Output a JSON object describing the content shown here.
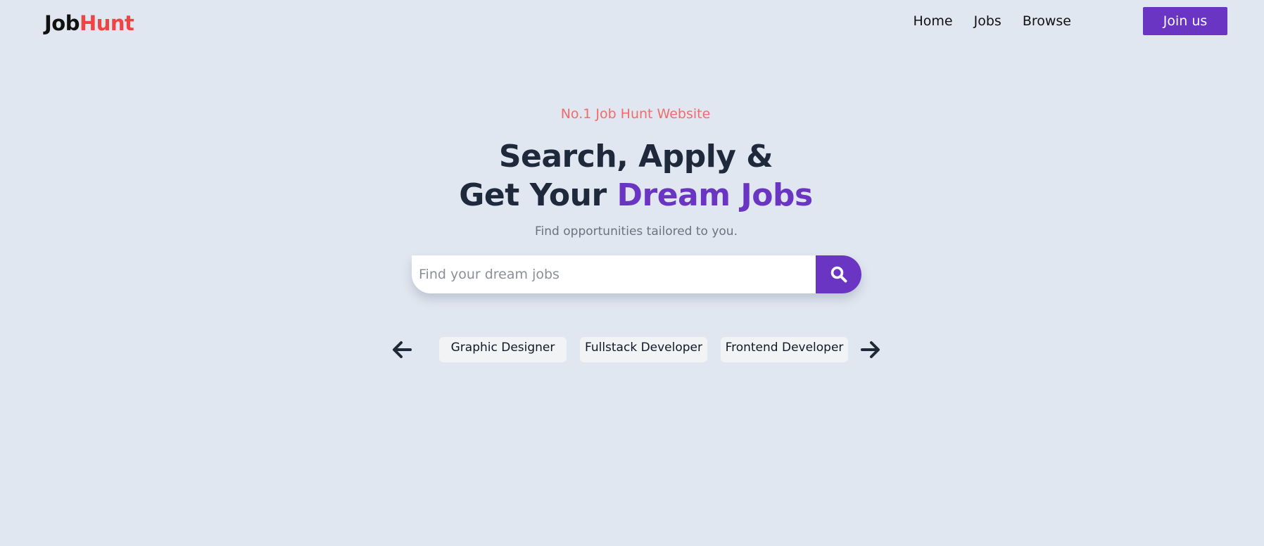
{
  "brand": {
    "part1": "Job",
    "part2": "Hunt"
  },
  "nav": {
    "links": [
      "Home",
      "Jobs",
      "Browse"
    ],
    "cta_label": "Join us"
  },
  "hero": {
    "badge": "No.1 Job Hunt Website",
    "headline_line1": "Search, Apply &",
    "headline_line2_prefix": "Get Your ",
    "headline_line2_accent": "Dream Jobs",
    "subtitle": "Find opportunities tailored to you."
  },
  "search": {
    "placeholder": "Find your dream jobs",
    "button_icon": "search-icon"
  },
  "categories": {
    "prev_icon": "arrow-left-icon",
    "next_icon": "arrow-right-icon",
    "items": [
      "Graphic Designer",
      "Fullstack Developer",
      "Frontend Developer"
    ]
  },
  "colors": {
    "background": "#e1e7f0",
    "accent": "#6a35c2",
    "brand_red": "#ef4444",
    "badge": "#f06b6b"
  }
}
